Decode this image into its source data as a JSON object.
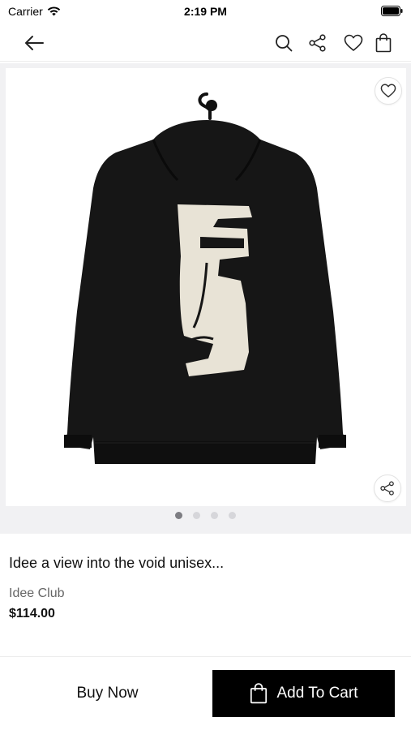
{
  "status_bar": {
    "carrier": "Carrier",
    "time": "2:19 PM"
  },
  "nav": {
    "icons": [
      "back-arrow-icon",
      "search-icon",
      "share-icon",
      "heart-icon",
      "shopping-bag-icon"
    ]
  },
  "gallery": {
    "image": "black hoodie with face artwork",
    "page_count": 4,
    "active_page": 1
  },
  "product": {
    "title": "Idee a view into the void unisex...",
    "brand": "Idee Club",
    "price": "$114.00"
  },
  "actions": {
    "buy_now": "Buy Now",
    "add_to_cart": "Add To Cart"
  },
  "colors": {
    "primary": "#000000",
    "background": "#ffffff",
    "gallery_bg": "#f1f1f3",
    "muted_text": "#666666"
  }
}
